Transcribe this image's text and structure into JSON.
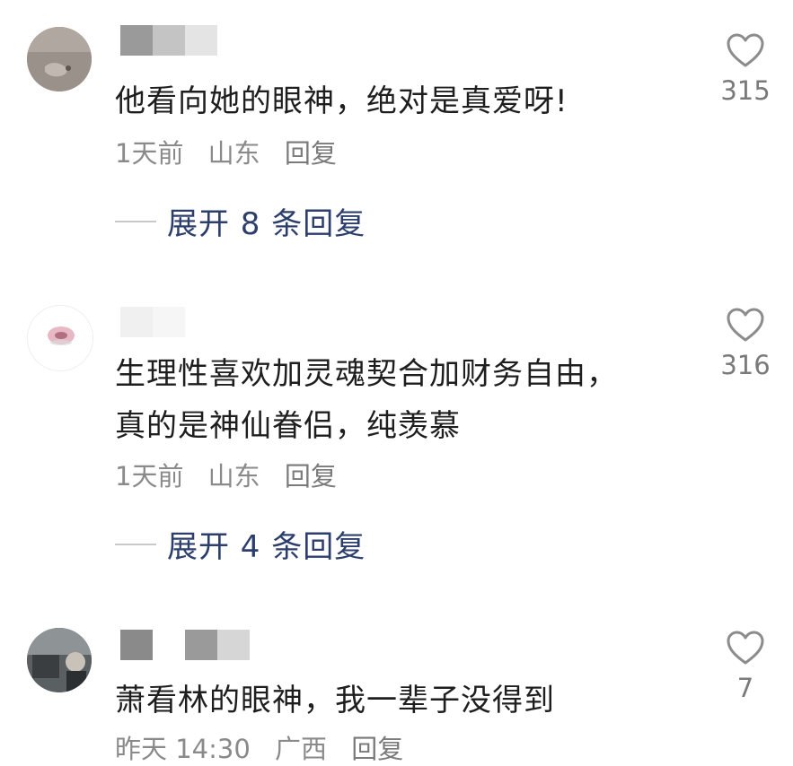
{
  "comments": [
    {
      "text": "他看向她的眼神，绝对是真爱呀!",
      "time": "1天前",
      "location": "山东",
      "reply_label": "回复",
      "expand_label": "展开 8 条回复",
      "likes": "315"
    },
    {
      "text": "生理性喜欢加灵魂契合加财务自由，真的是神仙眷侣，纯羡慕",
      "time": "1天前",
      "location": "山东",
      "reply_label": "回复",
      "expand_label": "展开 4 条回复",
      "likes": "316"
    },
    {
      "text": "萧看林的眼神，我一辈子没得到",
      "time": "昨天 14:30",
      "location": "广西",
      "reply_label": "回复",
      "likes": "7"
    }
  ],
  "colors": {
    "expand_link": "#2c3e6b",
    "meta": "#8a8a8a",
    "text": "#1e1e1e",
    "heart": "#8c8c8c"
  },
  "icons": {
    "like": "heart-outline-icon"
  }
}
